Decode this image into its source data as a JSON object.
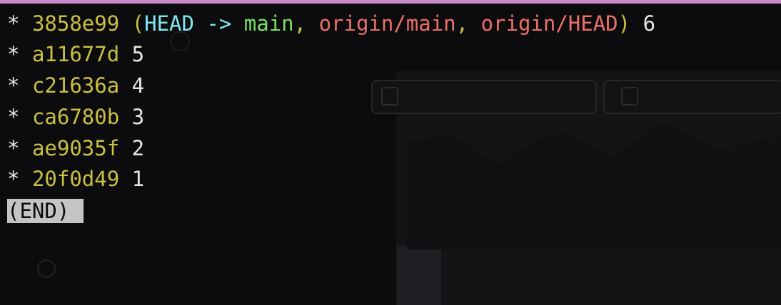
{
  "terminal": {
    "commits": [
      {
        "star": "*",
        "hash": "3858e99",
        "refs": {
          "open": "(",
          "head": "HEAD ->",
          "local_branch": "main",
          "sep1": ",",
          "remote_branch_1": "origin/main",
          "sep2": ",",
          "remote_branch_2": "origin/HEAD",
          "close": ")"
        },
        "message": "6"
      },
      {
        "star": "*",
        "hash": "a11677d",
        "message": "5"
      },
      {
        "star": "*",
        "hash": "c21636a",
        "message": "4"
      },
      {
        "star": "*",
        "hash": "ca6780b",
        "message": "3"
      },
      {
        "star": "*",
        "hash": "ae9035f",
        "message": "2"
      },
      {
        "star": "*",
        "hash": "20f0d49",
        "message": "1"
      }
    ],
    "pager_status": "(END)"
  },
  "colors": {
    "background": "#0c0c0e",
    "hash": "#c9c043",
    "head_ref": "#7ee8ee",
    "local_branch": "#76e05f",
    "remote_branch": "#ec6f68",
    "text": "#e6e6e6",
    "end_highlight": "#c4c4c4"
  }
}
